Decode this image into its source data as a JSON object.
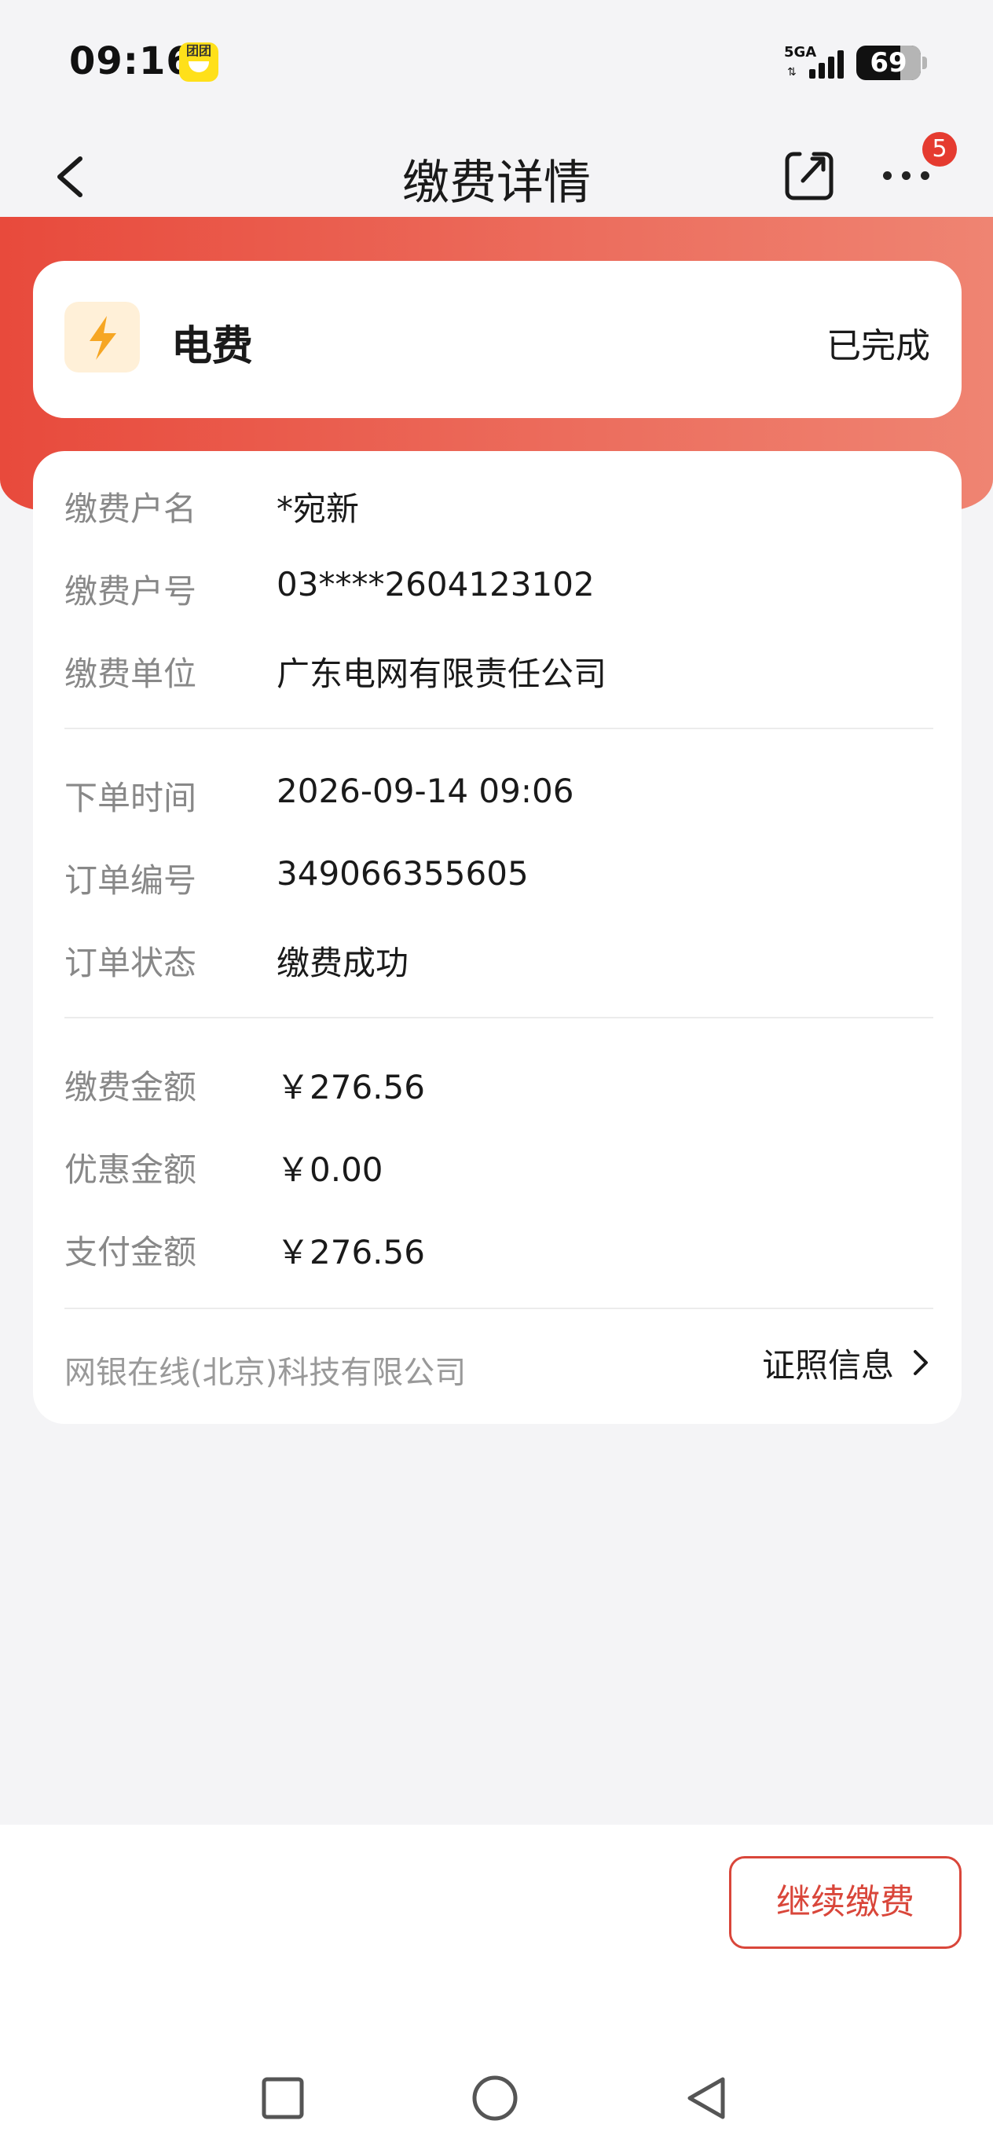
{
  "status_bar": {
    "time": "09:16",
    "app_badge_text": "团团",
    "network": "5GA",
    "battery": "69"
  },
  "nav": {
    "title": "缴费详情",
    "notification_count": "5"
  },
  "service": {
    "name": "电费",
    "status": "已完成",
    "icon": "lightning-icon"
  },
  "details": {
    "groups": [
      [
        {
          "label": "缴费户名",
          "value": "*宛新"
        },
        {
          "label": "缴费户号",
          "value": "03****2604123102"
        },
        {
          "label": "缴费单位",
          "value": "广东电网有限责任公司"
        }
      ],
      [
        {
          "label": "下单时间",
          "value": "2026-09-14 09:06"
        },
        {
          "label": "订单编号",
          "value": "349066355605"
        },
        {
          "label": "订单状态",
          "value": "缴费成功"
        }
      ],
      [
        {
          "label": "缴费金额",
          "value": "￥276.56"
        },
        {
          "label": "优惠金额",
          "value": "￥0.00"
        },
        {
          "label": "支付金额",
          "value": "￥276.56"
        }
      ]
    ]
  },
  "footer": {
    "company": "网银在线(北京)科技有限公司",
    "license_link": "证照信息"
  },
  "actions": {
    "continue_label": "继续缴费"
  },
  "colors": {
    "accent": "#e84a3c",
    "button_border": "#d9463a",
    "icon_bg": "#fff0d8",
    "icon_fg": "#f6a623"
  }
}
